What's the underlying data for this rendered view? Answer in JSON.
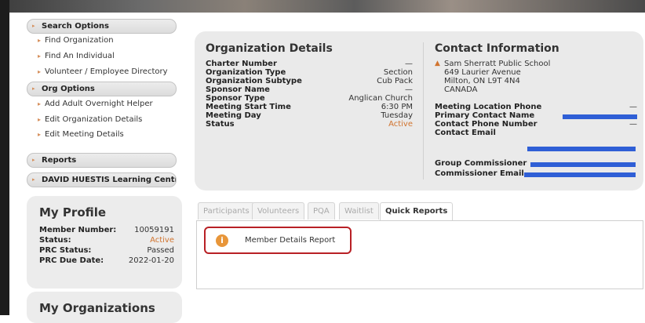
{
  "sidebar": {
    "sections": [
      {
        "label": "Search Options",
        "items": [
          "Find Organization",
          "Find An Individual",
          "Volunteer / Employee Directory"
        ]
      },
      {
        "label": "Org Options",
        "items": [
          "Add Adult Overnight Helper",
          "Edit Organization Details",
          "Edit Meeting Details"
        ]
      },
      {
        "label": "Reports",
        "items": []
      },
      {
        "label": "DAVID HUESTIS Learning Centre",
        "items": []
      }
    ]
  },
  "profile": {
    "title": "My Profile",
    "rows": [
      {
        "label": "Member Number:",
        "value": "10059191"
      },
      {
        "label": "Status:",
        "value": "Active"
      },
      {
        "label": "PRC Status:",
        "value": "Passed"
      },
      {
        "label": "PRC Due Date:",
        "value": "2022-01-20"
      }
    ]
  },
  "organizations": {
    "title": "My Organizations"
  },
  "org_details": {
    "title": "Organization Details",
    "rows": [
      {
        "label": "Charter Number",
        "value": "—"
      },
      {
        "label": "Organization Type",
        "value": "Section"
      },
      {
        "label": "Organization Subtype",
        "value": "Cub Pack"
      },
      {
        "label": "Sponsor Name",
        "value": "—"
      },
      {
        "label": "Sponsor Type",
        "value": "Anglican Church"
      },
      {
        "label": "Meeting Start Time",
        "value": "6:30 PM"
      },
      {
        "label": "Meeting Day",
        "value": "Tuesday"
      },
      {
        "label": "Status",
        "value": "Active"
      }
    ]
  },
  "contact": {
    "title": "Contact Information",
    "address": [
      "Sam Sherratt Public School",
      "649 Laurier Avenue",
      "Milton, ON L9T 4N4",
      "CANADA"
    ],
    "rows": [
      {
        "label": "Meeting Location Phone",
        "value": "—"
      },
      {
        "label": "Primary Contact Name",
        "value": ""
      },
      {
        "label": "Contact Phone Number",
        "value": "—"
      },
      {
        "label": "Contact Email",
        "value": ""
      },
      {
        "label": "Group Commissioner",
        "value": ""
      },
      {
        "label": "Commissioner Email",
        "value": ""
      }
    ]
  },
  "tabs": [
    "Participants",
    "Volunteers",
    "PQA",
    "Waitlist",
    "Quick Reports"
  ],
  "active_tab": "Quick Reports",
  "quick_reports": {
    "items": [
      {
        "label": "Member Details Report",
        "icon": "info-icon"
      }
    ]
  },
  "colors": {
    "accent_orange": "#d1742f",
    "highlight_red": "#b82025",
    "redaction_blue": "#2f5fd6",
    "panel_gray": "#eaeaea"
  }
}
